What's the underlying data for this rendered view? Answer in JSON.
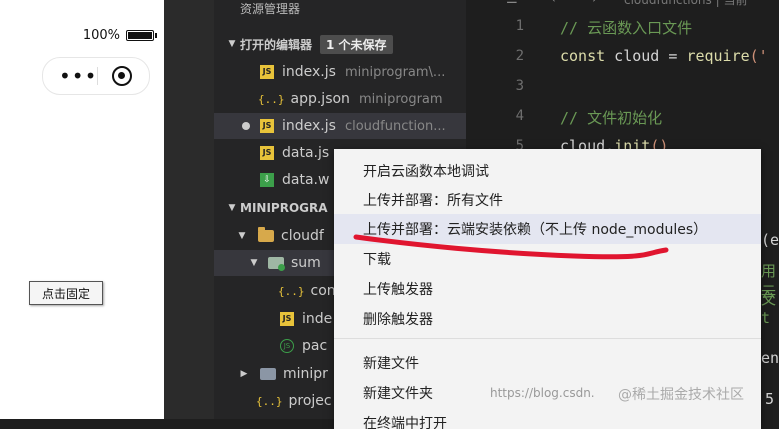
{
  "phone": {
    "status_percent": "100%",
    "capsule_menu_icon": "more-dots-icon",
    "capsule_close_icon": "record-circle-icon",
    "fixed_button_label": "点击固定"
  },
  "explorer": {
    "title": "资源管理器",
    "open_editors_label": "打开的编辑器",
    "unsaved_badge": "1 个未保存",
    "open_editors": [
      {
        "name": "index.js",
        "path": "miniprogram\\...",
        "icon": "js-file-icon"
      },
      {
        "name": "app.json",
        "path": "miniprogram",
        "icon": "json-file-icon"
      },
      {
        "name": "index.js",
        "path": "cloudfunction...",
        "icon": "js-file-icon",
        "unsaved": true
      },
      {
        "name": "data.js",
        "path": "",
        "icon": "js-file-icon"
      },
      {
        "name": "data.w",
        "path": "",
        "icon": "wxss-file-icon"
      }
    ],
    "project_section_label": "MINIPROGRA",
    "tree": [
      {
        "name": "cloudf",
        "icon": "cloud-folder-icon"
      },
      {
        "name": "sum",
        "icon": "cloud-function-folder-icon"
      },
      {
        "name": "con",
        "icon": "json-file-icon"
      },
      {
        "name": "inde",
        "icon": "js-file-icon"
      },
      {
        "name": "pac",
        "icon": "package-icon"
      },
      {
        "name": "minipr",
        "icon": "folder-icon"
      },
      {
        "name": "projec",
        "icon": "json-file-icon"
      }
    ]
  },
  "editor": {
    "tab_path": "cloudfunctions | 当前",
    "lines": [
      {
        "num": "1",
        "comment": "// 云函数入口文件"
      },
      {
        "num": "2",
        "kw": "const",
        "id": " cloud = ",
        "fn": "require",
        "str": "('"
      },
      {
        "num": "3"
      },
      {
        "num": "4",
        "comment": "// 文件初始化"
      },
      {
        "num": "5",
        "id": "cloud.",
        "fn": "init",
        "str": "()"
      }
    ],
    "frag_e": "(e",
    "frag_cloud1": "用云",
    "frag_cloud2": "文t",
    "frag_en": "en",
    "frag_5": "5"
  },
  "context_menu": {
    "items": [
      "开启云函数本地调试",
      "上传并部署：所有文件",
      "上传并部署：云端安装依赖（不上传 node_modules）",
      "下载",
      "上传触发器",
      "删除触发器",
      "新建文件",
      "新建文件夹",
      "在终端中打开"
    ],
    "highlight_color": "#e4e6f1",
    "annotation_color": "#e0152f"
  },
  "watermark": {
    "url": "https://blog.csdn.",
    "site": "@稀土掘金技术社区"
  }
}
